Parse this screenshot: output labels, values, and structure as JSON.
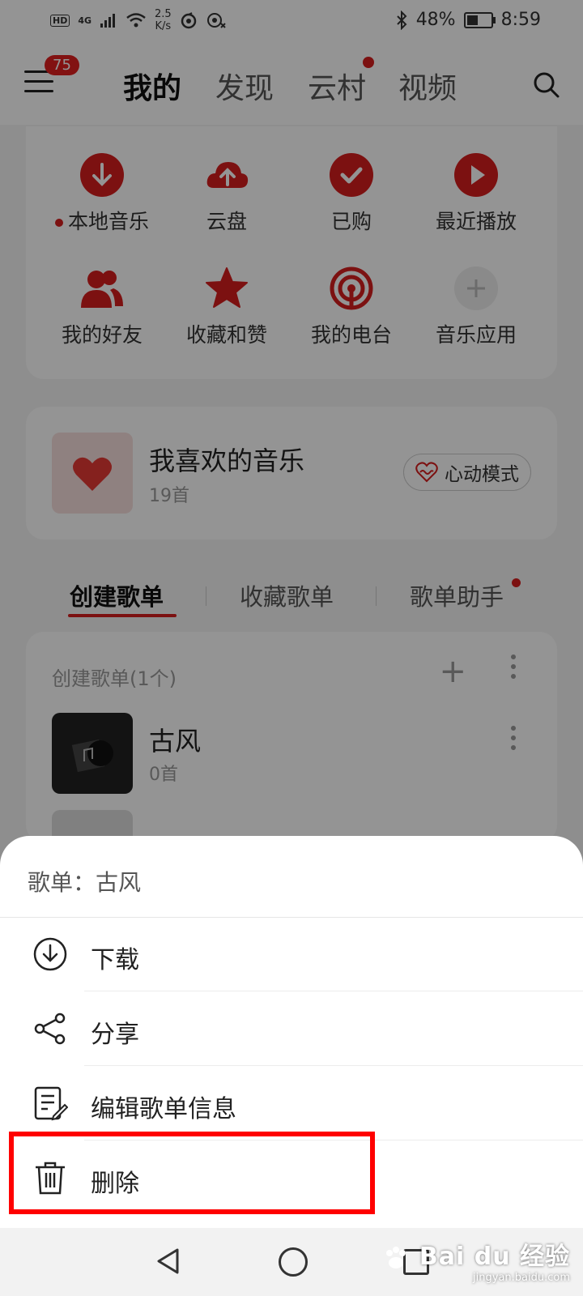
{
  "status_bar": {
    "hd": "HD",
    "network": "4G",
    "speed_value": "2.5",
    "speed_unit": "K/s",
    "battery": "48%",
    "battery_level": 0.48,
    "time": "8:59"
  },
  "top_nav": {
    "badge": "75",
    "tabs": [
      "我的",
      "发现",
      "云村",
      "视频"
    ]
  },
  "quick_access": [
    {
      "label": "本地音乐",
      "icon": "download-icon"
    },
    {
      "label": "云盘",
      "icon": "cloud-upload-icon"
    },
    {
      "label": "已购",
      "icon": "check-icon"
    },
    {
      "label": "最近播放",
      "icon": "play-icon"
    },
    {
      "label": "我的好友",
      "icon": "friends-icon"
    },
    {
      "label": "收藏和赞",
      "icon": "star-icon"
    },
    {
      "label": "我的电台",
      "icon": "radio-icon"
    },
    {
      "label": "音乐应用",
      "icon": "plus-icon"
    }
  ],
  "favorite": {
    "title": "我喜欢的音乐",
    "count": "19首",
    "mode_button": "心动模式"
  },
  "subtabs": [
    "创建歌单",
    "收藏歌单",
    "歌单助手"
  ],
  "playlists": {
    "header": "创建歌单(1个)",
    "items": [
      {
        "name": "古风",
        "count": "0首"
      }
    ]
  },
  "sheet": {
    "title": "歌单：古风",
    "options": [
      {
        "label": "下载",
        "icon": "download-icon"
      },
      {
        "label": "分享",
        "icon": "share-icon"
      },
      {
        "label": "编辑歌单信息",
        "icon": "edit-icon"
      },
      {
        "label": "删除",
        "icon": "trash-icon"
      }
    ]
  },
  "watermark": {
    "logo": "Bai du 经验",
    "url": "jingyan.baidu.com"
  },
  "colors": {
    "accent": "#d61e1e",
    "highlight": "#ff0000"
  }
}
